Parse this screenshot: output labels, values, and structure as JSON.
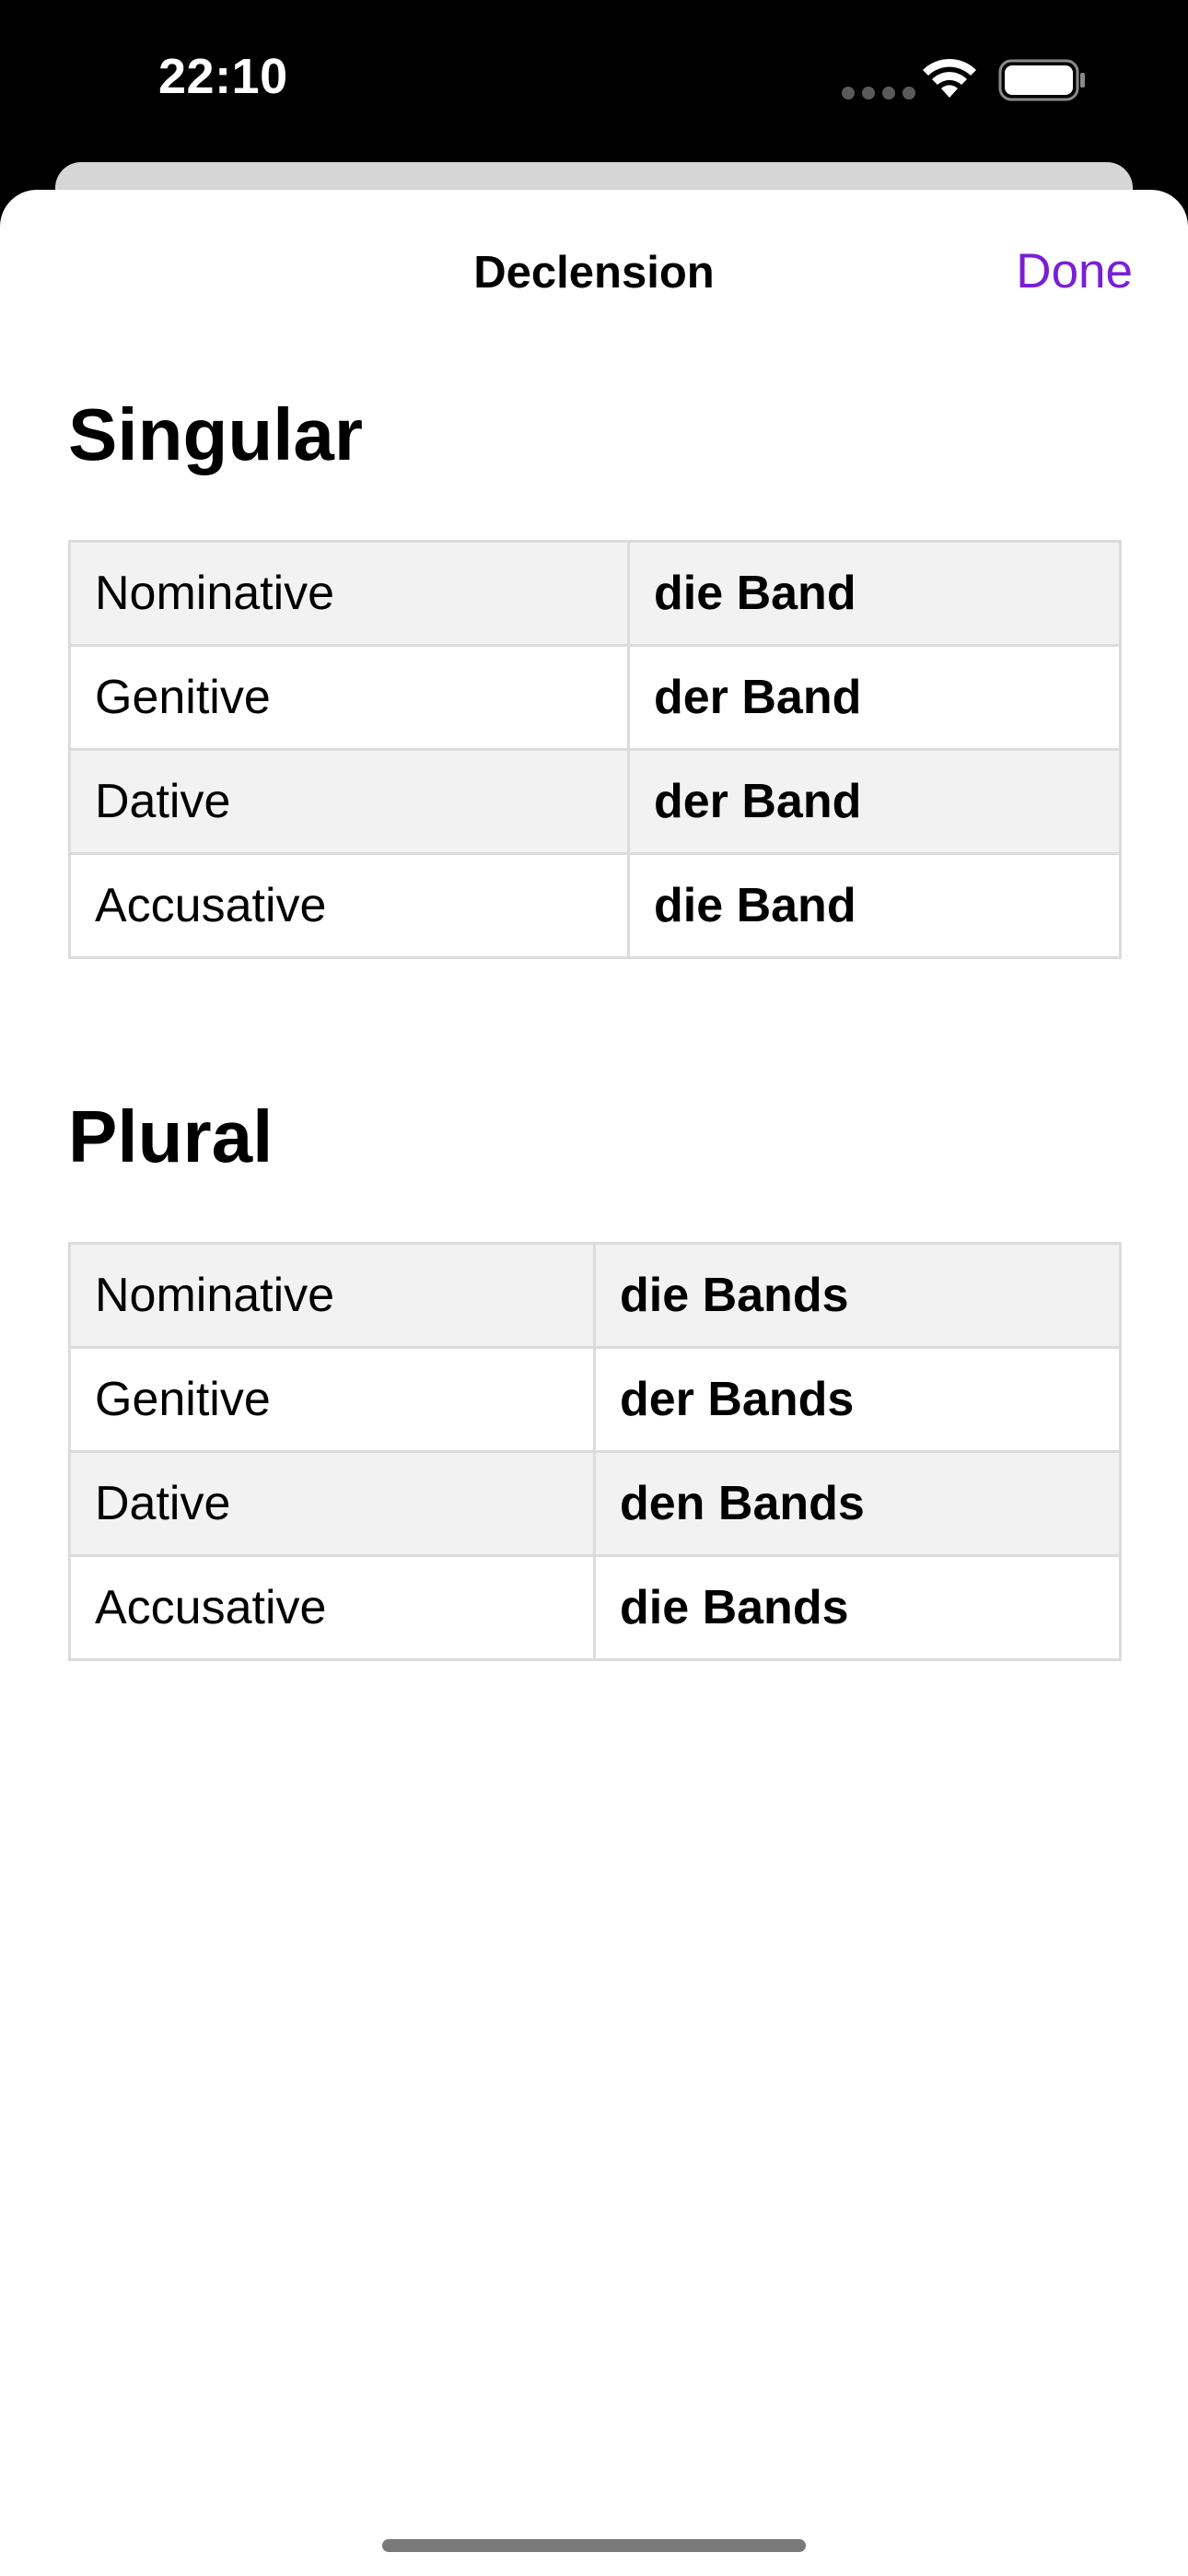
{
  "status_bar": {
    "time": "22:10"
  },
  "nav": {
    "title": "Declension",
    "done_label": "Done"
  },
  "colors": {
    "accent": "#7a1fd6",
    "row_shade": "#f2f2f2",
    "border": "#dcdcdc"
  },
  "singular": {
    "heading": "Singular",
    "rows": [
      {
        "case": "Nominative",
        "form": "die Band"
      },
      {
        "case": "Genitive",
        "form": "der Band"
      },
      {
        "case": "Dative",
        "form": "der Band"
      },
      {
        "case": "Accusative",
        "form": "die Band"
      }
    ]
  },
  "plural": {
    "heading": "Plural",
    "rows": [
      {
        "case": "Nominative",
        "form": "die Bands"
      },
      {
        "case": "Genitive",
        "form": "der Bands"
      },
      {
        "case": "Dative",
        "form": "den Bands"
      },
      {
        "case": "Accusative",
        "form": "die Bands"
      }
    ]
  },
  "icons": {
    "signal": "cellular-signal-icon",
    "wifi": "wifi-icon",
    "battery": "battery-icon"
  }
}
